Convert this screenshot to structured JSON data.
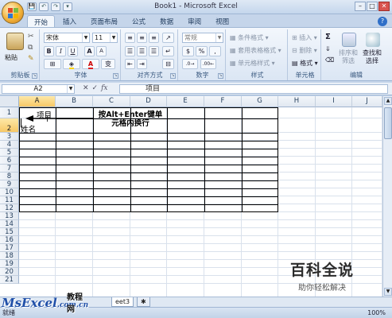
{
  "window": {
    "title": "Book1 - Microsoft Excel",
    "controls": [
      "–",
      "□",
      "✕"
    ]
  },
  "qat": [
    "💾",
    "↶",
    "↷",
    "▾"
  ],
  "tabs": [
    "开始",
    "插入",
    "页面布局",
    "公式",
    "数据",
    "审阅",
    "视图"
  ],
  "ribbon": {
    "clipboard": {
      "label": "剪贴板",
      "paste": "粘贴"
    },
    "font": {
      "label": "字体",
      "font_name": "宋体",
      "font_size": "11",
      "bold": "B",
      "italic": "I",
      "underline": "U",
      "grow": "A",
      "shrink": "A",
      "font_color_glyph": "A",
      "phonetic": "变"
    },
    "alignment": {
      "label": "对齐方式"
    },
    "number": {
      "label": "数字",
      "format": "常规",
      "percent": "%",
      "comma": ",",
      "currency": "$"
    },
    "styles": {
      "label": "样式",
      "conditional": "条件格式",
      "table": "套用表格格式",
      "cell_styles": "单元格样式"
    },
    "cells": {
      "label": "单元格",
      "insert": "插入",
      "delete": "删除",
      "format": "格式"
    },
    "editing": {
      "label": "编辑",
      "sort": "排序和",
      "sort2": "筛选",
      "find": "查找和",
      "find2": "选择",
      "sum": "Σ"
    }
  },
  "formula_bar": {
    "name_box": "A2",
    "content": "项目",
    "fx": "fx"
  },
  "columns": [
    "A",
    "B",
    "C",
    "D",
    "E",
    "F",
    "G",
    "H",
    "I",
    "J"
  ],
  "rows": [
    "1",
    "2",
    "3",
    "4",
    "5",
    "6",
    "7",
    "8",
    "9",
    "10",
    "11",
    "12",
    "13",
    "14",
    "15",
    "16",
    "17",
    "18",
    "19",
    "20",
    "21"
  ],
  "cells": {
    "a2_line1": "项目",
    "a2_line2": "姓名"
  },
  "annotation": "按Alt+Enter键单\n元格内换行",
  "sheet_tabs": [
    "eet3"
  ],
  "status": {
    "ready": "就绪",
    "zoom": "100%"
  },
  "watermarks": {
    "baike_big": "百科全说",
    "baike_small": "助你轻松解决",
    "msexcel": "MsExcel",
    "msexcel_suffix": ".com.cn",
    "msexcel_cn": "教程网"
  },
  "colors": {
    "accent": "#2b5797",
    "selection_header": "#f7c866",
    "border": "#000000"
  }
}
